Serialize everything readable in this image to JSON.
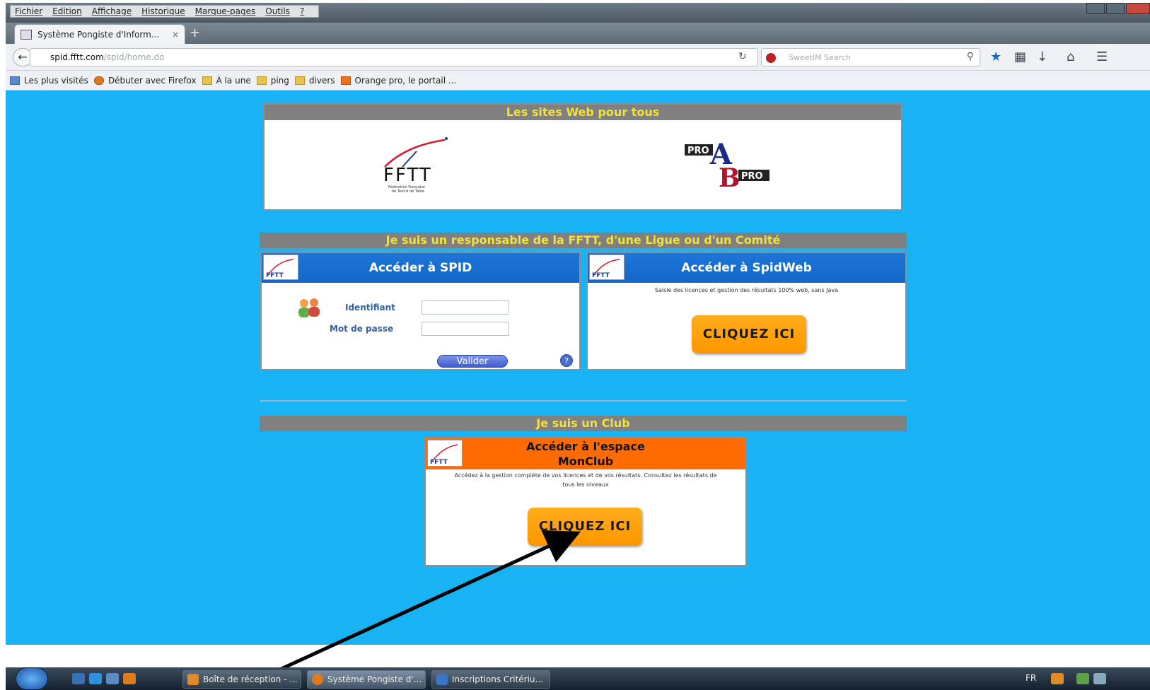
{
  "window": {
    "menu": [
      "Fichier",
      "Edition",
      "Affichage",
      "Historique",
      "Marque-pages",
      "Outils",
      "?"
    ]
  },
  "tab": {
    "title": "Système Pongiste d'Inform...",
    "close": "×",
    "new": "+"
  },
  "url": {
    "host": "spid.fftt.com",
    "path": "/spid/home.do"
  },
  "search": {
    "placeholder": "SweetIM Search"
  },
  "bookmarks": [
    "Les plus visités",
    "Débuter avec Firefox",
    "À la une",
    "ping",
    "divers",
    "Orange pro, le portail ..."
  ],
  "sites": {
    "header": "Les sites Web pour tous",
    "fftt_caption": "Fédération Française\nde Tennis de Table",
    "fftt_letters": "FFTT",
    "proapro_top": "PRO",
    "proapro_bottom": "PRO"
  },
  "responsable": {
    "header": "Je suis un responsable de la FFTT, d'une Ligue ou d'un Comité"
  },
  "spid": {
    "title": "Accéder à SPID",
    "login_label": "Identifiant",
    "password_label": "Mot de passe",
    "submit": "Valider",
    "help": "?"
  },
  "spidweb": {
    "title": "Accéder à SpidWeb",
    "description": "Saisie des licences et gestion des résultats 100% web, sans Java",
    "button": "CLIQUEZ ICI"
  },
  "club": {
    "header": "Je suis un Club",
    "title_line1": "Accéder à l'espace",
    "title_line2": "MonClub",
    "description_line1": "Accédez à la gestion complète de vos licences et de vos résultats. Consultez les résultats de",
    "description_line2": "tous les niveaux",
    "button": "CLIQUEZ ICI"
  },
  "taskbar": {
    "buttons": [
      "Boîte de réception - ...",
      "Système Pongiste d'...",
      "Inscriptions Critériu..."
    ],
    "tray": "FR"
  },
  "colors": {
    "page_bg": "#17b3f4",
    "header_gray": "#808080",
    "header_yellow": "#f2e23a",
    "spid_blue": "#1467c7",
    "club_orange": "#ff6b00",
    "button_orange": "#ff9c00"
  }
}
